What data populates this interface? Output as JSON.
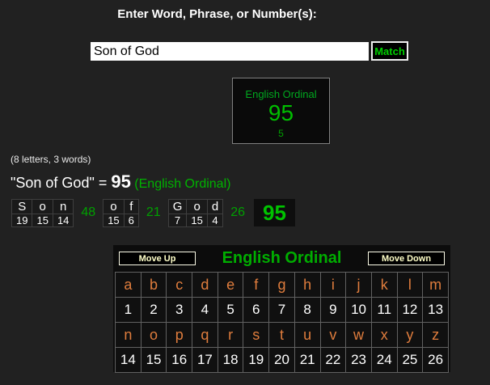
{
  "header": {
    "prompt": "Enter Word, Phrase, or Number(s):"
  },
  "search": {
    "value": "Son of God",
    "match_label": "Match"
  },
  "result_box": {
    "cipher": "English Ordinal",
    "value": "95",
    "reduced": "5"
  },
  "summary": {
    "letters_words": "(8 letters, 3 words)",
    "phrase": "\"Son of God\"",
    "equals": " = ",
    "value": "95",
    "cipher_label": " (English Ordinal)"
  },
  "breakdown": {
    "groups": [
      {
        "letters": [
          "S",
          "o",
          "n"
        ],
        "values": [
          "19",
          "15",
          "14"
        ],
        "sum": "48"
      },
      {
        "letters": [
          "o",
          "f"
        ],
        "values": [
          "15",
          "6"
        ],
        "sum": "21"
      },
      {
        "letters": [
          "G",
          "o",
          "d"
        ],
        "values": [
          "7",
          "15",
          "4"
        ],
        "sum": "26"
      }
    ],
    "total": "95"
  },
  "chart": {
    "move_up": "Move Up",
    "title": "English Ordinal",
    "move_down": "Move Down",
    "letter_rows": [
      {
        "letters": [
          "a",
          "b",
          "c",
          "d",
          "e",
          "f",
          "g",
          "h",
          "i",
          "j",
          "k",
          "l",
          "m"
        ],
        "values": [
          "1",
          "2",
          "3",
          "4",
          "5",
          "6",
          "7",
          "8",
          "9",
          "10",
          "11",
          "12",
          "13"
        ]
      },
      {
        "letters": [
          "n",
          "o",
          "p",
          "q",
          "r",
          "s",
          "t",
          "u",
          "v",
          "w",
          "x",
          "y",
          "z"
        ],
        "values": [
          "14",
          "15",
          "16",
          "17",
          "18",
          "19",
          "20",
          "21",
          "22",
          "23",
          "24",
          "25",
          "26"
        ]
      }
    ]
  },
  "colors": {
    "page_bg": "#212121",
    "panel_bg": "#0c0c0c",
    "green_bright": "#00c300",
    "green_label": "#00a800",
    "orange_letter": "#e07d3d",
    "button_text": "#ffffc8"
  }
}
